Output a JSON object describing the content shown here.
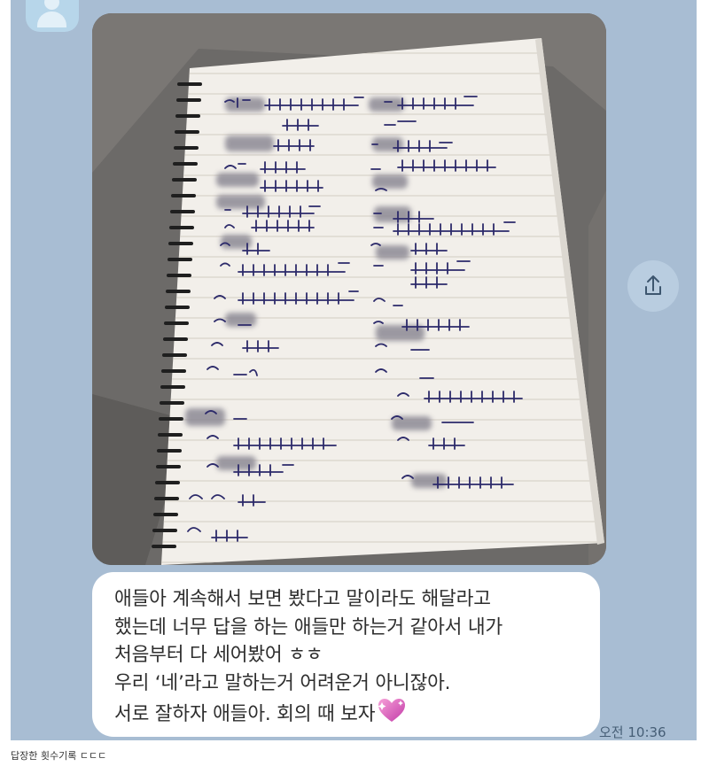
{
  "chat": {
    "background": "#a8bdd3",
    "sender_avatar": "person-avatar-icon",
    "photo": {
      "subject": "spiral notebook tally sheet"
    },
    "message": {
      "lines": [
        "애들아 계속해서 보면 봤다고 말이라도 해달라고",
        "했는데 너무 답을 하는 애들만 하는거 같아서 내가",
        "처음부터 다 세어봤어 ㅎㅎ",
        "우리 ‘네’라고 말하는거 어려운거 아니잖아.",
        "서로 잘하자 애들아. 회의 때 보자"
      ],
      "emoji": "sparkling-heart-icon"
    },
    "timestamp": "오전 10:36",
    "share_icon": "share-icon"
  },
  "caption": "답장한 횟수기록 ㄷㄷㄷ"
}
